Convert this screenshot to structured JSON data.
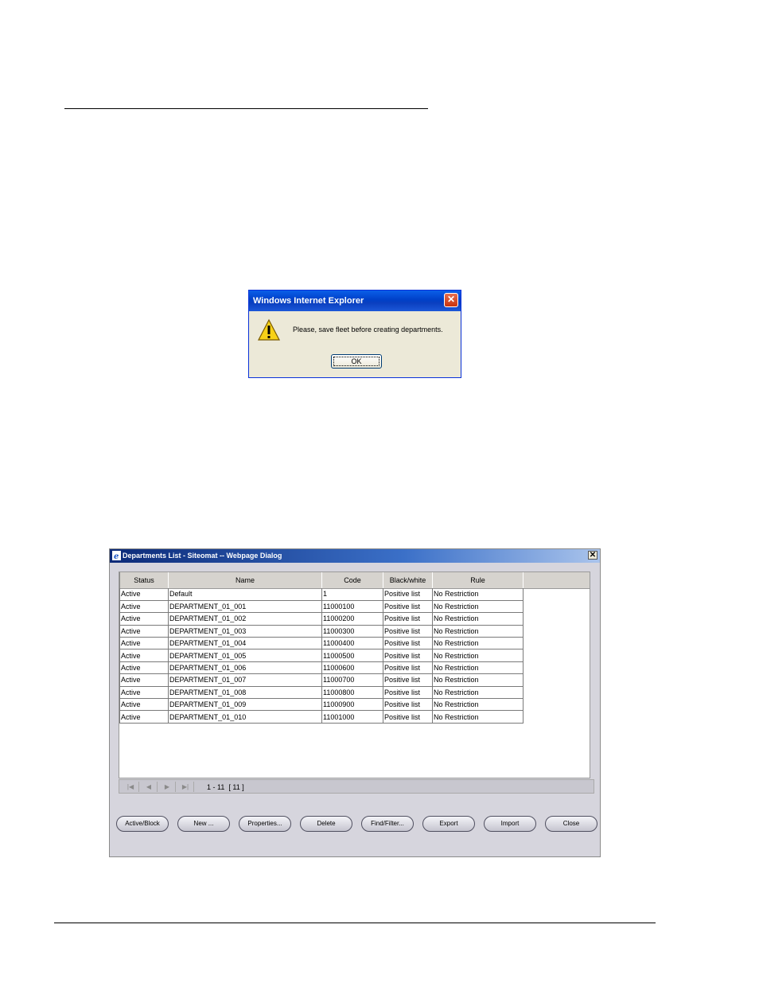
{
  "alert": {
    "title": "Windows Internet Explorer",
    "close_glyph": "✕",
    "message": "Please, save fleet before creating departments.",
    "ok_label": "OK",
    "icon": "warning-icon"
  },
  "departments_dialog": {
    "title": "Departments List - Siteomat -- Webpage Dialog",
    "close_glyph": "✕",
    "columns": [
      "Status",
      "Name",
      "Code",
      "Black/white",
      "Rule"
    ],
    "rows": [
      [
        "Active",
        "Default",
        "1",
        "Positive list",
        "No Restriction"
      ],
      [
        "Active",
        "DEPARTMENT_01_001",
        "11000100",
        "Positive list",
        "No Restriction"
      ],
      [
        "Active",
        "DEPARTMENT_01_002",
        "11000200",
        "Positive list",
        "No Restriction"
      ],
      [
        "Active",
        "DEPARTMENT_01_003",
        "11000300",
        "Positive list",
        "No Restriction"
      ],
      [
        "Active",
        "DEPARTMENT_01_004",
        "11000400",
        "Positive list",
        "No Restriction"
      ],
      [
        "Active",
        "DEPARTMENT_01_005",
        "11000500",
        "Positive list",
        "No Restriction"
      ],
      [
        "Active",
        "DEPARTMENT_01_006",
        "11000600",
        "Positive list",
        "No Restriction"
      ],
      [
        "Active",
        "DEPARTMENT_01_007",
        "11000700",
        "Positive list",
        "No Restriction"
      ],
      [
        "Active",
        "DEPARTMENT_01_008",
        "11000800",
        "Positive list",
        "No Restriction"
      ],
      [
        "Active",
        "DEPARTMENT_01_009",
        "11000900",
        "Positive list",
        "No Restriction"
      ],
      [
        "Active",
        "DEPARTMENT_01_010",
        "11001000",
        "Positive list",
        "No Restriction"
      ]
    ],
    "pager": {
      "first_glyph": "|◀",
      "prev_glyph": "◀",
      "next_glyph": "▶",
      "last_glyph": "▶|",
      "range_text": "1 - 11",
      "total_text": "[ 11 ]"
    },
    "buttons": [
      "Active/Block",
      "New ...",
      "Properties...",
      "Delete",
      "Find/Filter...",
      "Export",
      "Import",
      "Close"
    ]
  }
}
